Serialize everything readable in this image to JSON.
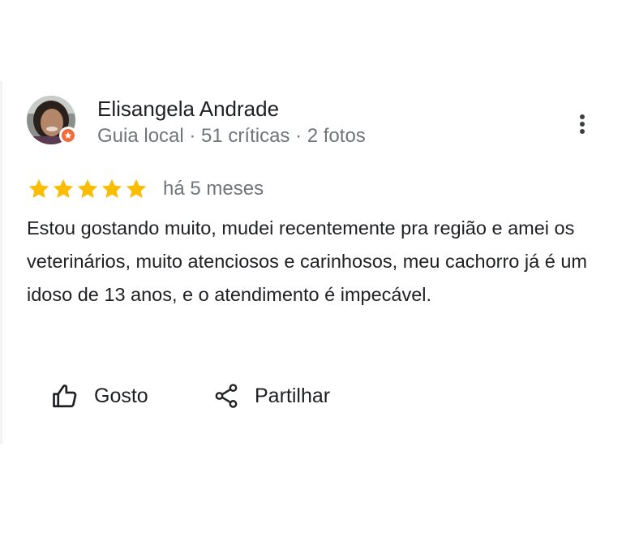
{
  "review": {
    "reviewer_name": "Elisangela Andrade",
    "reviewer_meta": "Guia local · 51 críticas · 2 fotos",
    "avatar_icon": "avatar-photo",
    "badge_color": "#f26b38",
    "rating": 5,
    "rating_max": 5,
    "star_color": "#fbbc04",
    "age": "há 5 meses",
    "text": "Estou gostando muito, mudei recentemente pra região e amei os veterinários, muito atenciosos e carinhosos, meu cachorro já é um idoso de 13 anos, e o atendimento é impecável."
  },
  "actions": {
    "like_label": "Gosto",
    "like_icon": "thumb-up-icon",
    "share_label": "Partilhar",
    "share_icon": "share-icon",
    "more_icon": "more-vert-icon"
  },
  "colors": {
    "text": "#202124",
    "secondary_text": "#70757a"
  }
}
